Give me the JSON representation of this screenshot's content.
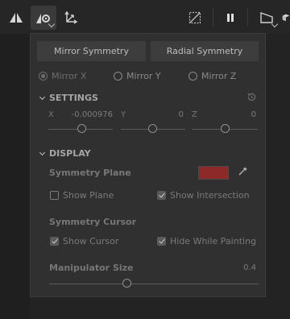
{
  "toolbar": {
    "icons": [
      "symmetry-mirror-icon",
      "symmetry-settings-icon",
      "transform-axes-icon",
      "hidden-grid-icon",
      "pause-icon",
      "camera-view-icon",
      "cube-view-icon"
    ]
  },
  "panel": {
    "mirror_symmetry_label": "Mirror Symmetry",
    "radial_symmetry_label": "Radial Symmetry",
    "axes": [
      {
        "label": "Mirror X",
        "checked": true
      },
      {
        "label": "Mirror Y",
        "checked": false
      },
      {
        "label": "Mirror Z",
        "checked": false
      }
    ],
    "settings": {
      "title": "SETTINGS",
      "x_label": "X",
      "x_value": "-0.000976",
      "y_label": "Y",
      "y_value": "0",
      "z_label": "Z",
      "z_value": "0"
    },
    "display": {
      "title": "DISPLAY",
      "symmetry_plane_label": "Symmetry Plane",
      "plane_color": "#8c2a2a",
      "show_plane_label": "Show Plane",
      "show_plane_checked": false,
      "show_intersection_label": "Show Intersection",
      "show_intersection_checked": true,
      "symmetry_cursor_label": "Symmetry Cursor",
      "show_cursor_label": "Show Cursor",
      "show_cursor_checked": true,
      "hide_while_painting_label": "Hide While Painting",
      "hide_while_painting_checked": true,
      "manipulator_size_label": "Manipulator Size",
      "manipulator_size_value": "0.4",
      "manipulator_size_fraction": 0.37
    }
  }
}
